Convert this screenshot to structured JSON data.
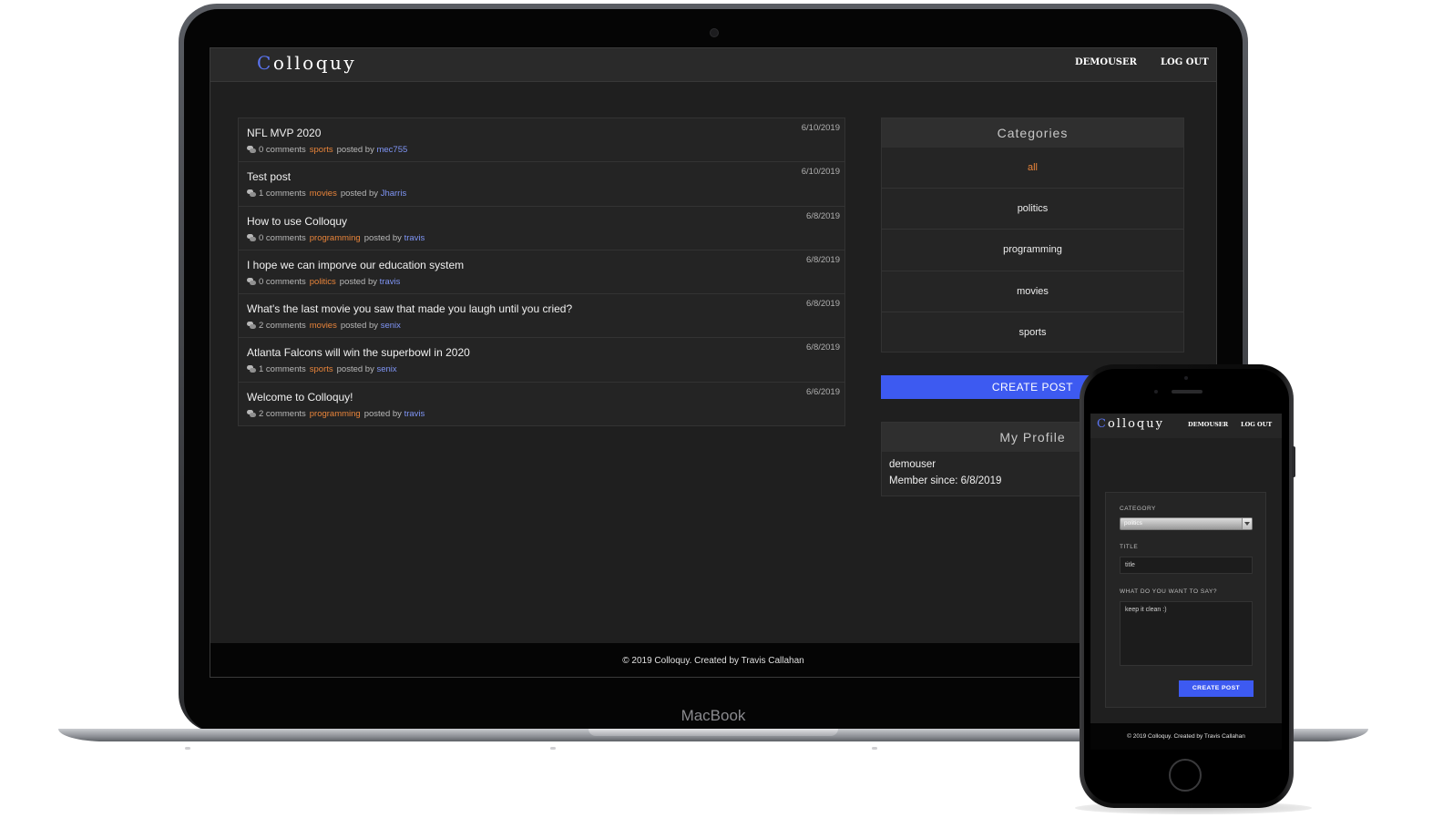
{
  "app": {
    "logo_first": "C",
    "logo_rest": "olloquy"
  },
  "nav": {
    "user": "DEMOUSER",
    "logout": "LOG OUT"
  },
  "posts": [
    {
      "title": "NFL MVP 2020",
      "comments": "0 comments",
      "category": "sports",
      "posted_by": "posted by",
      "user": "mec755",
      "date": "6/10/2019"
    },
    {
      "title": "Test post",
      "comments": "1 comments",
      "category": "movies",
      "posted_by": "posted by",
      "user": "Jharris",
      "date": "6/10/2019"
    },
    {
      "title": "How to use Colloquy",
      "comments": "0 comments",
      "category": "programming",
      "posted_by": "posted by",
      "user": "travis",
      "date": "6/8/2019"
    },
    {
      "title": "I hope we can imporve our education system",
      "comments": "0 comments",
      "category": "politics",
      "posted_by": "posted by",
      "user": "travis",
      "date": "6/8/2019"
    },
    {
      "title": "What's the last movie you saw that made you laugh until you cried?",
      "comments": "2 comments",
      "category": "movies",
      "posted_by": "posted by",
      "user": "senix",
      "date": "6/8/2019"
    },
    {
      "title": "Atlanta Falcons will win the superbowl in 2020",
      "comments": "1 comments",
      "category": "sports",
      "posted_by": "posted by",
      "user": "senix",
      "date": "6/8/2019"
    },
    {
      "title": "Welcome to Colloquy!",
      "comments": "2 comments",
      "category": "programming",
      "posted_by": "posted by",
      "user": "travis",
      "date": "6/6/2019"
    }
  ],
  "categories": {
    "title": "Categories",
    "items": [
      "all",
      "politics",
      "programming",
      "movies",
      "sports"
    ],
    "active": "all"
  },
  "create_post_label": "CREATE POST",
  "profile": {
    "title": "My Profile",
    "username": "demouser",
    "member_since": "Member since: 6/8/2019"
  },
  "footer": "© 2019 Colloquy. Created by Travis Callahan",
  "device_label": "MacBook",
  "mobile_form": {
    "category_label": "CATEGORY",
    "category_value": "politics",
    "title_label": "TITLE",
    "title_value": "title",
    "body_label": "WHAT DO YOU WANT TO SAY?",
    "body_value": "keep it clean :)",
    "submit_label": "CREATE POST"
  },
  "colors": {
    "accent_blue": "#3d5af1",
    "category_orange": "#e8843a",
    "user_link": "#7f95f5",
    "background": "#1f1f1f"
  }
}
